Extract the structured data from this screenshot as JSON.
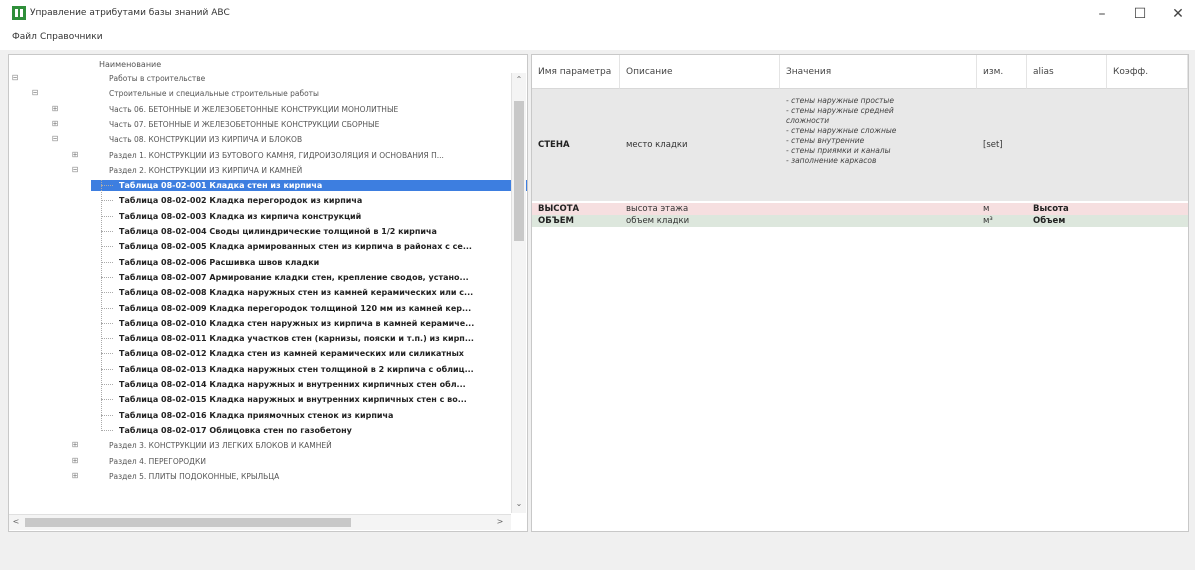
{
  "window": {
    "title": "Управление атрибутами базы знаний АВС",
    "minimize": "–",
    "maximize": "☐",
    "close": "✕"
  },
  "menu": {
    "items": [
      "Файл",
      "Справочники"
    ]
  },
  "tree": {
    "header": "Наименование",
    "rows": [
      {
        "label": "Работы в строительстве",
        "toggle": "⊟"
      },
      {
        "label": "Строительные и специальные строительные работы",
        "toggle": "⊟"
      },
      {
        "label": "Часть 06. БЕТОННЫЕ И ЖЕЛЕЗОБЕТОННЫЕ КОНСТРУКЦИИ МОНОЛИТНЫЕ",
        "toggle": "⊞"
      },
      {
        "label": "Часть 07. БЕТОННЫЕ И ЖЕЛЕЗОБЕТОННЫЕ КОНСТРУКЦИИ СБОРНЫЕ",
        "toggle": "⊞"
      },
      {
        "label": "Часть 08. КОНСТРУКЦИИ ИЗ КИРПИЧА И БЛОКОВ",
        "toggle": "⊟"
      },
      {
        "label": "Раздел 1. КОНСТРУКЦИИ ИЗ БУТОВОГО КАМНЯ, ГИДРОИЗОЛЯЦИЯ И ОСНОВАНИЯ П...",
        "toggle": "⊞"
      },
      {
        "label": "Раздел 2. КОНСТРУКЦИИ ИЗ КИРПИЧА И КАМНЕЙ",
        "toggle": "⊟"
      },
      {
        "label": "Таблица 08-02-001 Кладка стен из кирпича",
        "toggle": ""
      },
      {
        "label": "Таблица 08-02-002 Кладка перегородок из кирпича",
        "toggle": ""
      },
      {
        "label": "Таблица 08-02-003 Кладка из кирпича конструкций",
        "toggle": ""
      },
      {
        "label": "Таблица 08-02-004 Своды цилиндрические толщиной в 1/2 кирпича",
        "toggle": ""
      },
      {
        "label": "Таблица 08-02-005 Кладка армированных стен из кирпича в районах с се...",
        "toggle": ""
      },
      {
        "label": "Таблица 08-02-006 Расшивка швов кладки",
        "toggle": ""
      },
      {
        "label": "Таблица 08-02-007 Армирование кладки стен, крепление сводов, устано...",
        "toggle": ""
      },
      {
        "label": "Таблица 08-02-008 Кладка наружных стен из камней керамических или с...",
        "toggle": ""
      },
      {
        "label": "Таблица 08-02-009 Кладка перегородок толщиной 120 мм из камней кер...",
        "toggle": ""
      },
      {
        "label": "Таблица 08-02-010 Кладка стен наружных из кирпича в камней керамиче...",
        "toggle": ""
      },
      {
        "label": "Таблица 08-02-011 Кладка участков стен (карнизы, пояски и т.п.) из кирп...",
        "toggle": ""
      },
      {
        "label": "Таблица 08-02-012 Кладка стен из камней керамических или силикатных",
        "toggle": ""
      },
      {
        "label": "Таблица 08-02-013 Кладка наружных стен толщиной в 2 кирпича с облиц...",
        "toggle": ""
      },
      {
        "label": "Таблица 08-02-014 Кладка наружных и внутренних кирпичных стен обл...",
        "toggle": ""
      },
      {
        "label": "Таблица 08-02-015 Кладка наружных и внутренних кирпичных стен с во...",
        "toggle": ""
      },
      {
        "label": "Таблица 08-02-016 Кладка приямочных стенок из кирпича",
        "toggle": ""
      },
      {
        "label": "Таблица 08-02-017 Облицовка стен по газобетону",
        "toggle": ""
      },
      {
        "label": "Раздел 3. КОНСТРУКЦИИ ИЗ ЛЕГКИХ БЛОКОВ И КАМНЕЙ",
        "toggle": "⊞"
      },
      {
        "label": "Раздел 4. ПЕРЕГОРОДКИ",
        "toggle": "⊞"
      },
      {
        "label": "Раздел 5. ПЛИТЫ ПОДОКОННЫЕ, КРЫЛЬЦА",
        "toggle": "⊞"
      }
    ],
    "selected_index": 7,
    "scroll_up": "⌃",
    "scroll_down": "⌄",
    "scroll_left": "<",
    "scroll_right": ">"
  },
  "grid": {
    "columns": [
      "Имя параметра",
      "Описание",
      "Значения",
      "изм.",
      "alias",
      "Коэфф."
    ],
    "rows": [
      {
        "name": "СТЕНА",
        "description": "место кладки",
        "values": [
          "- стены наружные простые",
          "- стены наружные средней",
          "сложности",
          "- стены наружные сложные",
          "- стены внутренние",
          "- стены приямки и каналы",
          "- заполнение каркасов"
        ],
        "unit": "[set]",
        "alias": "",
        "coef": "",
        "bg": "#e8e8e8"
      },
      {
        "name": "ВЫСОТА",
        "description": "высота этажа",
        "values": [],
        "unit": "м",
        "alias": "Высота",
        "coef": "",
        "bg": "#f6dfe0"
      },
      {
        "name": "ОБЪЕМ",
        "description": "объем кладки",
        "values": [],
        "unit": "м³",
        "alias": "Объем",
        "coef": "",
        "bg": "#dde7dd"
      }
    ]
  },
  "colors": {
    "selection": "#3d7ee0",
    "row_gray": "#e8e8e8",
    "row_pink": "#f6dfe0",
    "row_green": "#dde7dd"
  }
}
